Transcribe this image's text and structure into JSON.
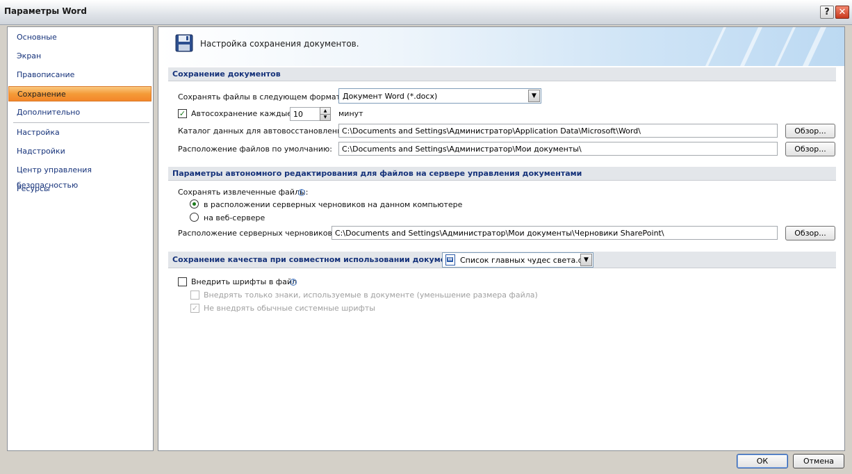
{
  "window": {
    "title": "Параметры Word",
    "help": "?",
    "close": "✕"
  },
  "sidebar": {
    "items": [
      {
        "label": "Основные"
      },
      {
        "label": "Экран"
      },
      {
        "label": "Правописание"
      },
      {
        "label": "Сохранение"
      },
      {
        "label": "Дополнительно"
      },
      {
        "label": "Настройка"
      },
      {
        "label": "Надстройки"
      },
      {
        "label": "Центр управления безопасностью"
      },
      {
        "label": "Ресурсы"
      }
    ],
    "active_label": "Сохранение"
  },
  "banner": {
    "title": "Настройка сохранения документов."
  },
  "save_section": {
    "header": "Сохранение документов",
    "format_label": "Сохранять файлы в следующем формате:",
    "format_value": "Документ Word (*.docx)",
    "autosave_label": "Автосохранение каждые",
    "autosave_checked": true,
    "autosave_value": "10",
    "autosave_unit": "минут",
    "recovery_label": "Каталог данных для автовосстановления:",
    "recovery_path": "C:\\Documents and Settings\\Администратор\\Application Data\\Microsoft\\Word\\",
    "default_location_label": "Расположение файлов по умолчанию:",
    "default_location_path": "C:\\Documents and Settings\\Администратор\\Мои документы\\",
    "browse_label": "Обзор..."
  },
  "offline_section": {
    "header": "Параметры автономного редактирования для файлов на сервере управления документами",
    "save_checked_out_label": "Сохранять извлеченные файлы:",
    "option_local": "в расположении серверных черновиков на данном компьютере",
    "option_web": "на веб-сервере",
    "selected_option": "option_local",
    "drafts_location_label": "Расположение серверных черновиков:",
    "drafts_location_path": "C:\\Documents and Settings\\Администратор\\Мои документы\\Черновики SharePoint\\",
    "browse_label": "Обзор..."
  },
  "fidelity_section": {
    "header": "Сохранение качества при совместном использовании документа:",
    "document_value": "Список главных чудес света.doc",
    "embed_fonts_label": "Внедрить шрифты в файл",
    "embed_fonts_checked": false,
    "embed_only_chars_label": "Внедрять только знаки, используемые в документе (уменьшение размера файла)",
    "embed_only_chars_checked": false,
    "no_common_fonts_label": "Не внедрять обычные системные шрифты",
    "no_common_fonts_checked": true
  },
  "footer": {
    "ok_label": "ОК",
    "cancel_label": "Отмена"
  },
  "icons": {
    "save": "floppy-disk-icon",
    "info": "info-icon",
    "dropdown": "chevron-down-icon",
    "doc": "word-document-icon"
  },
  "colors": {
    "active_nav": "#f49b38",
    "link_text": "#15327a",
    "check": "#1a7a1a"
  }
}
